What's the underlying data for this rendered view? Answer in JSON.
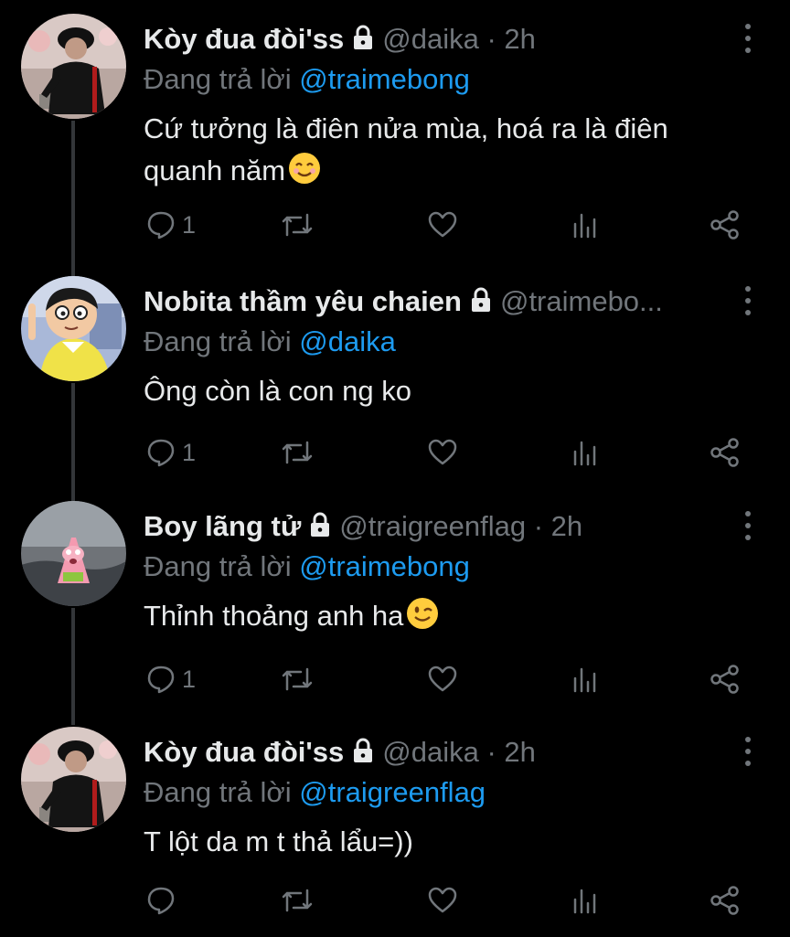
{
  "colors": {
    "background": "#000000",
    "primary_text": "#e7e9ea",
    "secondary_text": "#71767b",
    "mention": "#1d9bf0",
    "thread_line": "#333639"
  },
  "tweets": [
    {
      "name": "Kòy đua đòi'ss",
      "handle": "@daika",
      "time": "· 2h",
      "replying_to_label": "Đang trả lời",
      "replying_to": "@traimebong",
      "text": "Cứ tưởng là điên nửa mùa, hoá ra là điên quanh năm",
      "emoji": "smiling-face-icon",
      "reply_count": "1",
      "avatar": "avatar-black-hoodie"
    },
    {
      "name": "Nobita thầm yêu chaien",
      "handle": "@traimebo...",
      "time": "",
      "replying_to_label": "Đang trả lời",
      "replying_to": "@daika",
      "text": "Ông còn là con ng ko",
      "emoji": "",
      "reply_count": "1",
      "avatar": "avatar-cartoon-boy"
    },
    {
      "name": "Boy lãng tử",
      "handle": "@traigreenflag",
      "time": "· 2h",
      "replying_to_label": "Đang trả lời",
      "replying_to": "@traimebong",
      "text": "Thỉnh thoảng anh ha",
      "emoji": "winking-face-icon",
      "reply_count": "1",
      "avatar": "avatar-pink-starfish"
    },
    {
      "name": "Kòy đua đòi'ss",
      "handle": "@daika",
      "time": "· 2h",
      "replying_to_label": "Đang trả lời",
      "replying_to": "@traigreenflag",
      "text": "T lột da m t thả lẩu=))",
      "emoji": "",
      "reply_count": "",
      "avatar": "avatar-black-hoodie"
    }
  ]
}
